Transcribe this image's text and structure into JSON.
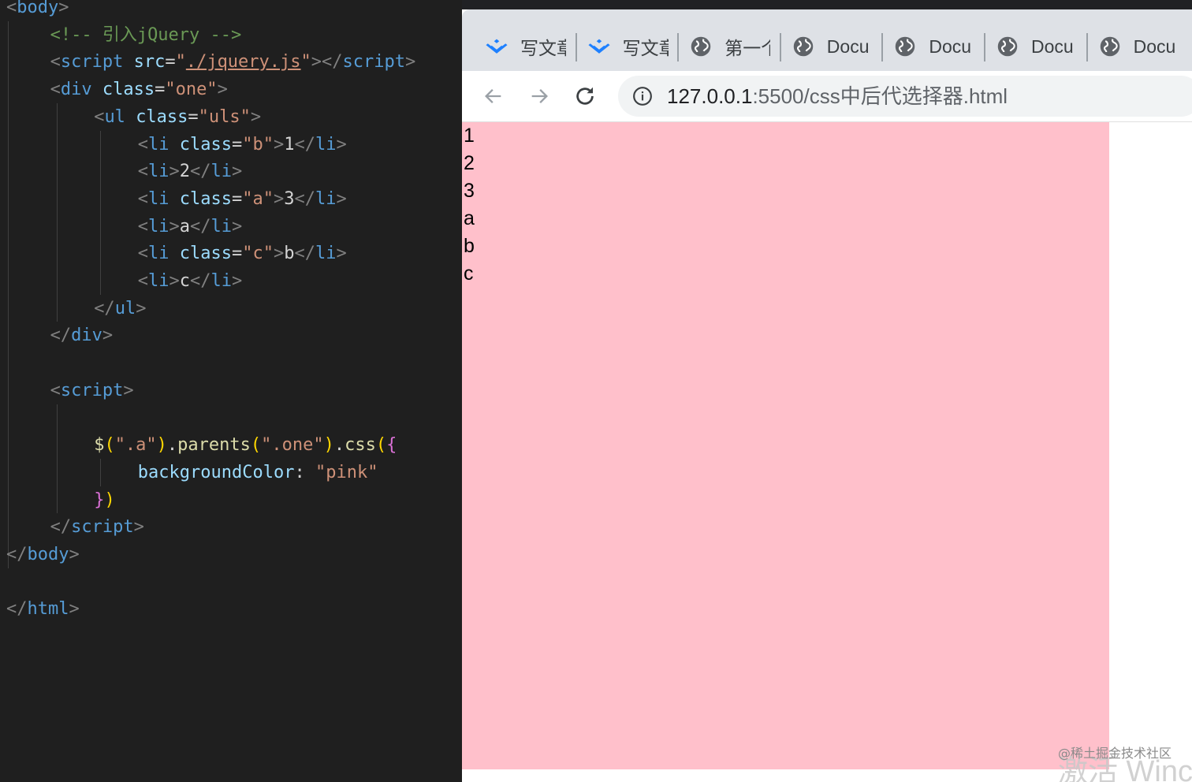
{
  "editor": {
    "lines": [
      {
        "indent": 0,
        "tokens": [
          {
            "c": "bracket",
            "t": "<"
          },
          {
            "c": "tag",
            "t": "body"
          },
          {
            "c": "bracket",
            "t": ">"
          }
        ]
      },
      {
        "indent": 2,
        "tokens": [
          {
            "c": "comment",
            "t": "<!-- 引入jQuery -->"
          }
        ]
      },
      {
        "indent": 2,
        "tokens": [
          {
            "c": "bracket",
            "t": "<"
          },
          {
            "c": "tag",
            "t": "script"
          },
          {
            "c": "text",
            "t": " "
          },
          {
            "c": "attr",
            "t": "src"
          },
          {
            "c": "text",
            "t": "="
          },
          {
            "c": "str",
            "t": "\""
          },
          {
            "c": "str link",
            "t": "./jquery.js"
          },
          {
            "c": "str",
            "t": "\""
          },
          {
            "c": "bracket",
            "t": "></"
          },
          {
            "c": "tag",
            "t": "script"
          },
          {
            "c": "bracket",
            "t": ">"
          }
        ]
      },
      {
        "indent": 2,
        "tokens": [
          {
            "c": "bracket",
            "t": "<"
          },
          {
            "c": "tag",
            "t": "div"
          },
          {
            "c": "text",
            "t": " "
          },
          {
            "c": "attr",
            "t": "class"
          },
          {
            "c": "text",
            "t": "="
          },
          {
            "c": "str",
            "t": "\"one\""
          },
          {
            "c": "bracket",
            "t": ">"
          }
        ]
      },
      {
        "indent": 4,
        "tokens": [
          {
            "c": "bracket",
            "t": "<"
          },
          {
            "c": "tag",
            "t": "ul"
          },
          {
            "c": "text",
            "t": " "
          },
          {
            "c": "attr",
            "t": "class"
          },
          {
            "c": "text",
            "t": "="
          },
          {
            "c": "str",
            "t": "\"uls\""
          },
          {
            "c": "bracket",
            "t": ">"
          }
        ]
      },
      {
        "indent": 6,
        "tokens": [
          {
            "c": "bracket",
            "t": "<"
          },
          {
            "c": "tag",
            "t": "li"
          },
          {
            "c": "text",
            "t": " "
          },
          {
            "c": "attr",
            "t": "class"
          },
          {
            "c": "text",
            "t": "="
          },
          {
            "c": "str",
            "t": "\"b\""
          },
          {
            "c": "bracket",
            "t": ">"
          },
          {
            "c": "text",
            "t": "1"
          },
          {
            "c": "bracket",
            "t": "</"
          },
          {
            "c": "tag",
            "t": "li"
          },
          {
            "c": "bracket",
            "t": ">"
          }
        ]
      },
      {
        "indent": 6,
        "tokens": [
          {
            "c": "bracket",
            "t": "<"
          },
          {
            "c": "tag",
            "t": "li"
          },
          {
            "c": "bracket",
            "t": ">"
          },
          {
            "c": "text",
            "t": "2"
          },
          {
            "c": "bracket",
            "t": "</"
          },
          {
            "c": "tag",
            "t": "li"
          },
          {
            "c": "bracket",
            "t": ">"
          }
        ]
      },
      {
        "indent": 6,
        "tokens": [
          {
            "c": "bracket",
            "t": "<"
          },
          {
            "c": "tag",
            "t": "li"
          },
          {
            "c": "text",
            "t": " "
          },
          {
            "c": "attr",
            "t": "class"
          },
          {
            "c": "text",
            "t": "="
          },
          {
            "c": "str",
            "t": "\"a\""
          },
          {
            "c": "bracket",
            "t": ">"
          },
          {
            "c": "text",
            "t": "3"
          },
          {
            "c": "bracket",
            "t": "</"
          },
          {
            "c": "tag",
            "t": "li"
          },
          {
            "c": "bracket",
            "t": ">"
          }
        ]
      },
      {
        "indent": 6,
        "tokens": [
          {
            "c": "bracket",
            "t": "<"
          },
          {
            "c": "tag",
            "t": "li"
          },
          {
            "c": "bracket",
            "t": ">"
          },
          {
            "c": "text",
            "t": "a"
          },
          {
            "c": "bracket",
            "t": "</"
          },
          {
            "c": "tag",
            "t": "li"
          },
          {
            "c": "bracket",
            "t": ">"
          }
        ]
      },
      {
        "indent": 6,
        "tokens": [
          {
            "c": "bracket",
            "t": "<"
          },
          {
            "c": "tag",
            "t": "li"
          },
          {
            "c": "text",
            "t": " "
          },
          {
            "c": "attr",
            "t": "class"
          },
          {
            "c": "text",
            "t": "="
          },
          {
            "c": "str",
            "t": "\"c\""
          },
          {
            "c": "bracket",
            "t": ">"
          },
          {
            "c": "text",
            "t": "b"
          },
          {
            "c": "bracket",
            "t": "</"
          },
          {
            "c": "tag",
            "t": "li"
          },
          {
            "c": "bracket",
            "t": ">"
          }
        ]
      },
      {
        "indent": 6,
        "tokens": [
          {
            "c": "bracket",
            "t": "<"
          },
          {
            "c": "tag",
            "t": "li"
          },
          {
            "c": "bracket",
            "t": ">"
          },
          {
            "c": "text",
            "t": "c"
          },
          {
            "c": "bracket",
            "t": "</"
          },
          {
            "c": "tag",
            "t": "li"
          },
          {
            "c": "bracket",
            "t": ">"
          }
        ]
      },
      {
        "indent": 4,
        "tokens": [
          {
            "c": "bracket",
            "t": "</"
          },
          {
            "c": "tag",
            "t": "ul"
          },
          {
            "c": "bracket",
            "t": ">"
          }
        ]
      },
      {
        "indent": 2,
        "tokens": [
          {
            "c": "bracket",
            "t": "</"
          },
          {
            "c": "tag",
            "t": "div"
          },
          {
            "c": "bracket",
            "t": ">"
          }
        ]
      },
      {
        "indent": 0,
        "tokens": []
      },
      {
        "indent": 2,
        "tokens": [
          {
            "c": "bracket",
            "t": "<"
          },
          {
            "c": "tag",
            "t": "script"
          },
          {
            "c": "bracket",
            "t": ">"
          }
        ]
      },
      {
        "indent": 0,
        "tokens": []
      },
      {
        "indent": 4,
        "tokens": [
          {
            "c": "fn",
            "t": "$"
          },
          {
            "c": "paren",
            "t": "("
          },
          {
            "c": "str",
            "t": "\".a\""
          },
          {
            "c": "paren",
            "t": ")"
          },
          {
            "c": "text",
            "t": "."
          },
          {
            "c": "fn",
            "t": "parents"
          },
          {
            "c": "paren",
            "t": "("
          },
          {
            "c": "str",
            "t": "\".one\""
          },
          {
            "c": "paren",
            "t": ")"
          },
          {
            "c": "text",
            "t": "."
          },
          {
            "c": "fn",
            "t": "css"
          },
          {
            "c": "paren",
            "t": "("
          },
          {
            "c": "brace",
            "t": "{"
          }
        ]
      },
      {
        "indent": 6,
        "tokens": [
          {
            "c": "prop",
            "t": "backgroundColor"
          },
          {
            "c": "text",
            "t": ": "
          },
          {
            "c": "str",
            "t": "\"pink\""
          }
        ]
      },
      {
        "indent": 4,
        "tokens": [
          {
            "c": "brace",
            "t": "}"
          },
          {
            "c": "paren",
            "t": ")"
          }
        ]
      },
      {
        "indent": 2,
        "tokens": [
          {
            "c": "bracket",
            "t": "</"
          },
          {
            "c": "tag",
            "t": "script"
          },
          {
            "c": "bracket",
            "t": ">"
          }
        ]
      },
      {
        "indent": 0,
        "tokens": [
          {
            "c": "bracket",
            "t": "</"
          },
          {
            "c": "tag",
            "t": "body"
          },
          {
            "c": "bracket",
            "t": ">"
          }
        ]
      },
      {
        "indent": 0,
        "tokens": []
      },
      {
        "indent": 0,
        "tokens": [
          {
            "c": "bracket",
            "t": "</"
          },
          {
            "c": "tag",
            "t": "html"
          },
          {
            "c": "bracket",
            "t": ">"
          }
        ]
      }
    ]
  },
  "browser": {
    "tabs": [
      {
        "label": "写文章",
        "icon": "juejin-icon"
      },
      {
        "label": "写文章",
        "icon": "juejin-icon"
      },
      {
        "label": "第一个",
        "icon": "globe-icon"
      },
      {
        "label": "Docu",
        "icon": "globe-icon"
      },
      {
        "label": "Docu",
        "icon": "globe-icon"
      },
      {
        "label": "Docu",
        "icon": "globe-icon"
      },
      {
        "label": "Docu",
        "icon": "globe-icon"
      }
    ],
    "url_host": "127.0.0.1",
    "url_path": ":5500/css中后代选择器.html",
    "page": {
      "background": "#ffc0cb",
      "list_items": [
        "1",
        "2",
        "3",
        "a",
        "b",
        "c"
      ]
    },
    "watermark": "@稀土掘金技术社区",
    "activate_text": "激活 Winc"
  },
  "colors": {
    "juejin_blue": "#1e80ff",
    "globe_gray": "#5f6368",
    "pink": "#ffc0cb"
  }
}
